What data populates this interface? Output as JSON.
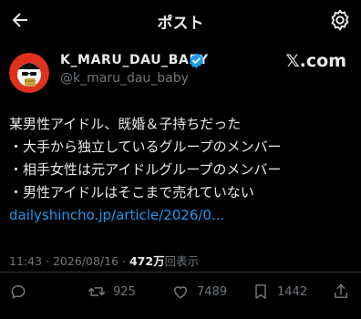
{
  "header": {
    "title": "ポスト",
    "back_icon": "arrow-left-icon",
    "settings_icon": "gear-icon"
  },
  "author": {
    "name": "K_MARU_DAU_BABY",
    "handle": "@k_maru_dau_baby",
    "verified": true,
    "source": "𝕏.com"
  },
  "post": {
    "lines": [
      "某男性アイドル、既婚＆子持ちだった",
      "・大手から独立しているグループのメンバー",
      "・相手女性は元アイドルグループのメンバー",
      "・男性アイドルはそこまで売れていない"
    ],
    "link": "dailyshincho.jp/article/2026/0..."
  },
  "meta": {
    "time": "11:43",
    "date": "2026/08/16",
    "separator": "·",
    "views": "472万",
    "views_label": "回表示"
  },
  "actions": {
    "reply_count": "",
    "retweet_count": "925",
    "like_count": "7489",
    "bookmark_count": "1442"
  },
  "colors": {
    "background": "#000000",
    "text": "#e7e9ea",
    "muted": "#71767b",
    "link": "#1d9bf0"
  }
}
